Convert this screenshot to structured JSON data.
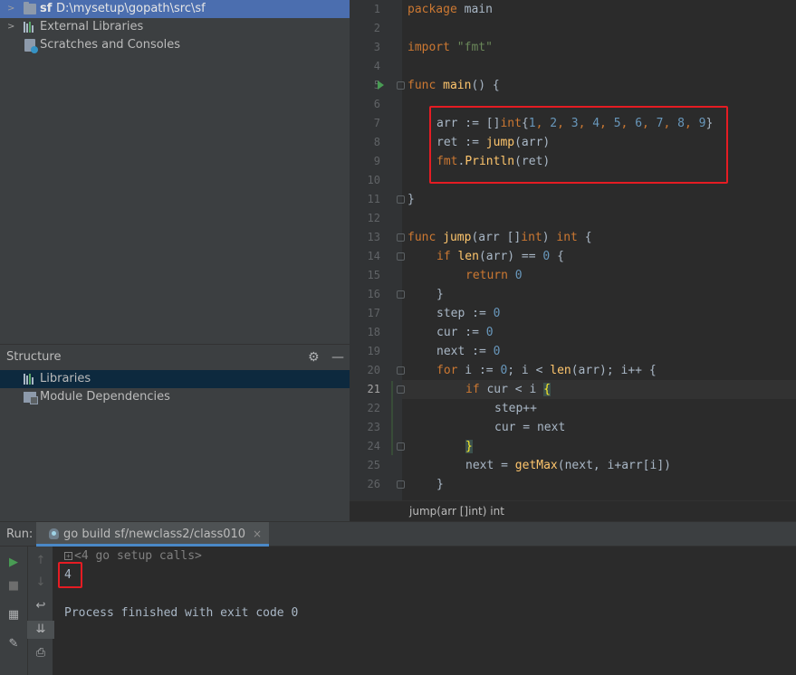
{
  "project": {
    "root": {
      "name": "sf",
      "path": "D:\\mysetup\\gopath\\src\\sf"
    },
    "external_libraries": "External Libraries",
    "scratches": "Scratches and Consoles"
  },
  "structure": {
    "title": "Structure",
    "items": [
      "Libraries",
      "Module Dependencies"
    ]
  },
  "editor": {
    "line_numbers": [
      "1",
      "2",
      "3",
      "4",
      "5",
      "6",
      "7",
      "8",
      "9",
      "10",
      "11",
      "12",
      "13",
      "14",
      "15",
      "16",
      "17",
      "18",
      "19",
      "20",
      "21",
      "22",
      "23",
      "24",
      "25",
      "26"
    ],
    "code": {
      "l1_kw": "package",
      "l1_rest": " main",
      "l3_kw": "import",
      "l3_str": "\"fmt\"",
      "l5_kw": "func",
      "l5_fn": "main",
      "l5_rest": "() {",
      "l7_a": "arr := []",
      "l7_type": "int",
      "l7_b": "{",
      "l7_nums": [
        "1",
        "2",
        "3",
        "4",
        "5",
        "6",
        "7",
        "8",
        "9"
      ],
      "l7_c": "}",
      "l8_a": "ret := ",
      "l8_fn": "jump",
      "l8_b": "(arr)",
      "l9_pkg": "fmt",
      "l9_dot": ".",
      "l9_fn": "Println",
      "l9_b": "(ret)",
      "l11": "}",
      "l13_kw": "func",
      "l13_fn": "jump",
      "l13_a": "(arr []",
      "l13_t1": "int",
      "l13_b": ") ",
      "l13_t2": "int",
      "l13_c": " {",
      "l14_kw": "if",
      "l14_fn": "len",
      "l14_a": "(arr) == ",
      "l14_num": "0",
      "l14_b": " {",
      "l15_kw": "return",
      "l15_num": "0",
      "l16": "}",
      "l17_a": "step := ",
      "l17_num": "0",
      "l18_a": "cur := ",
      "l18_num": "0",
      "l19_a": "next := ",
      "l19_num": "0",
      "l20_kw": "for",
      "l20_a": " i := ",
      "l20_num": "0",
      "l20_b": "; i < ",
      "l20_fn": "len",
      "l20_c": "(arr); i++ {",
      "l21_kw": "if",
      "l21_a": " cur < i ",
      "l21_brace": "{",
      "l22": "step++",
      "l23": "cur = next",
      "l24": "}",
      "l25_a": "next = ",
      "l25_fn": "getMax",
      "l25_b": "(next, i+arr[i])",
      "l26": "}"
    },
    "breadcrumb": "jump(arr []int) int"
  },
  "run": {
    "label": "Run:",
    "tab": "go build sf/newclass2/class010",
    "close": "×",
    "console": {
      "setup_calls": "<4 go setup calls>",
      "output": "4",
      "exit": "Process finished with exit code 0"
    }
  },
  "colors": {
    "selection": "#4b6eaf",
    "highlight_box": "#e51c23",
    "keyword": "#cc7832",
    "function": "#ffc66d",
    "number": "#6897bb",
    "string": "#6a8759"
  }
}
